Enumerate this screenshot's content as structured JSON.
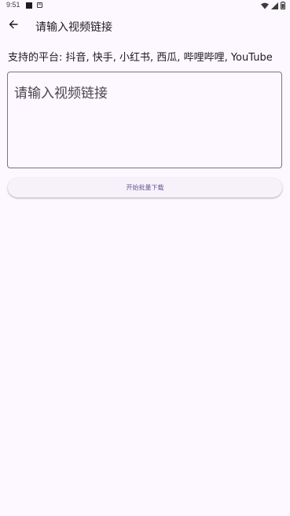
{
  "status_bar": {
    "time": "9:51",
    "notification_icons": [
      "square-notification-icon",
      "a-notification-icon"
    ],
    "system_icons": [
      "wifi-icon",
      "signal-icon",
      "battery-icon"
    ]
  },
  "app_bar": {
    "back_icon": "arrow-left-icon",
    "title": "请输入视频链接"
  },
  "platforms_text": "支持的平台: 抖音, 快手, 小红书, 西瓜, 哔哩哔哩, YouTube",
  "link_input": {
    "placeholder": "请输入视频链接",
    "value": ""
  },
  "download_button": {
    "label": "开始批量下载"
  },
  "colors": {
    "background": "#fdf7ff",
    "outline": "#79747e",
    "button_text": "#65558f",
    "button_bg": "#f7f2fa"
  }
}
